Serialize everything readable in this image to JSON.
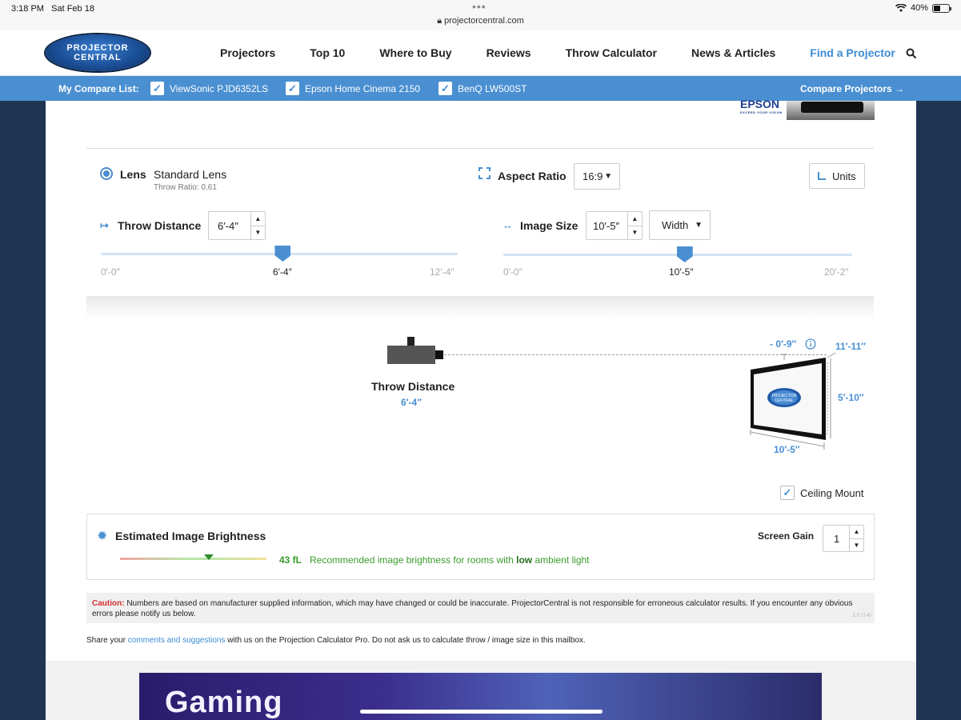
{
  "status": {
    "time": "3:18 PM",
    "date": "Sat Feb 18",
    "url": "projectorcentral.com",
    "battery": "40%",
    "wifi_icon": "wifi-icon"
  },
  "nav": {
    "logo_line1": "PROJECTOR",
    "logo_line2": "CENTRAL",
    "links": [
      "Projectors",
      "Top 10",
      "Where to Buy",
      "Reviews",
      "Throw Calculator",
      "News & Articles",
      "Find a Projector"
    ],
    "search_icon": "search-icon"
  },
  "compare": {
    "label": "My Compare List:",
    "items": [
      "ViewSonic PJD6352LS",
      "Epson Home Cinema 2150",
      "BenQ LW500ST"
    ],
    "button": "Compare Projectors →"
  },
  "ad_top": {
    "brand": "EPSON",
    "tagline": "EXCEED YOUR VISION"
  },
  "calc": {
    "lens_label": "Lens",
    "lens_value": "Standard Lens",
    "throw_ratio": "Throw Ratio: 0.61",
    "aspect_label": "Aspect Ratio",
    "aspect_value": "16:9",
    "units_label": "Units",
    "throw_label": "Throw Distance",
    "throw_value": "6′-4″",
    "throw_min": "0′-0″",
    "throw_current": "6′-4″",
    "throw_max": "12′-4″",
    "throw_fraction": 0.51,
    "image_label": "Image Size",
    "image_value": "10′-5″",
    "image_dim": "Width",
    "image_min": "0′-0″",
    "image_current": "10′-5″",
    "image_max": "20′-2″",
    "image_fraction": 0.52
  },
  "diagram": {
    "throw_title": "Throw Distance",
    "throw_value": "6′-4″",
    "offset": "- 0′-9″",
    "diagonal": "11′-11″",
    "height": "5′-10″",
    "width": "10′-5″",
    "screen_logo_1": "PROJECTOR",
    "screen_logo_2": "CENTRAL",
    "ceiling_label": "Ceiling Mount",
    "ceiling_checked": true
  },
  "brightness": {
    "title": "Estimated Image Brightness",
    "gain_label": "Screen Gain",
    "gain_value": "1",
    "fl_value": "43 fL",
    "text_before": "Recommended image brightness for rooms with",
    "text_bold": "low",
    "text_after": "ambient light"
  },
  "caution": {
    "label": "Caution:",
    "text": "Numbers are based on manufacturer supplied information, which may have changed or could be inaccurate. ProjectorCentral is not responsible for erroneous calculator results. If you encounter any obvious errors please notify us below.",
    "version": "3.0 (14)"
  },
  "share": {
    "before": "Share your",
    "link": "comments and suggestions",
    "after": "with us on the Projection Calculator Pro. Do not ask us to calculate throw / image size in this mailbox."
  },
  "ad_bottom": {
    "text": "Gaming"
  }
}
